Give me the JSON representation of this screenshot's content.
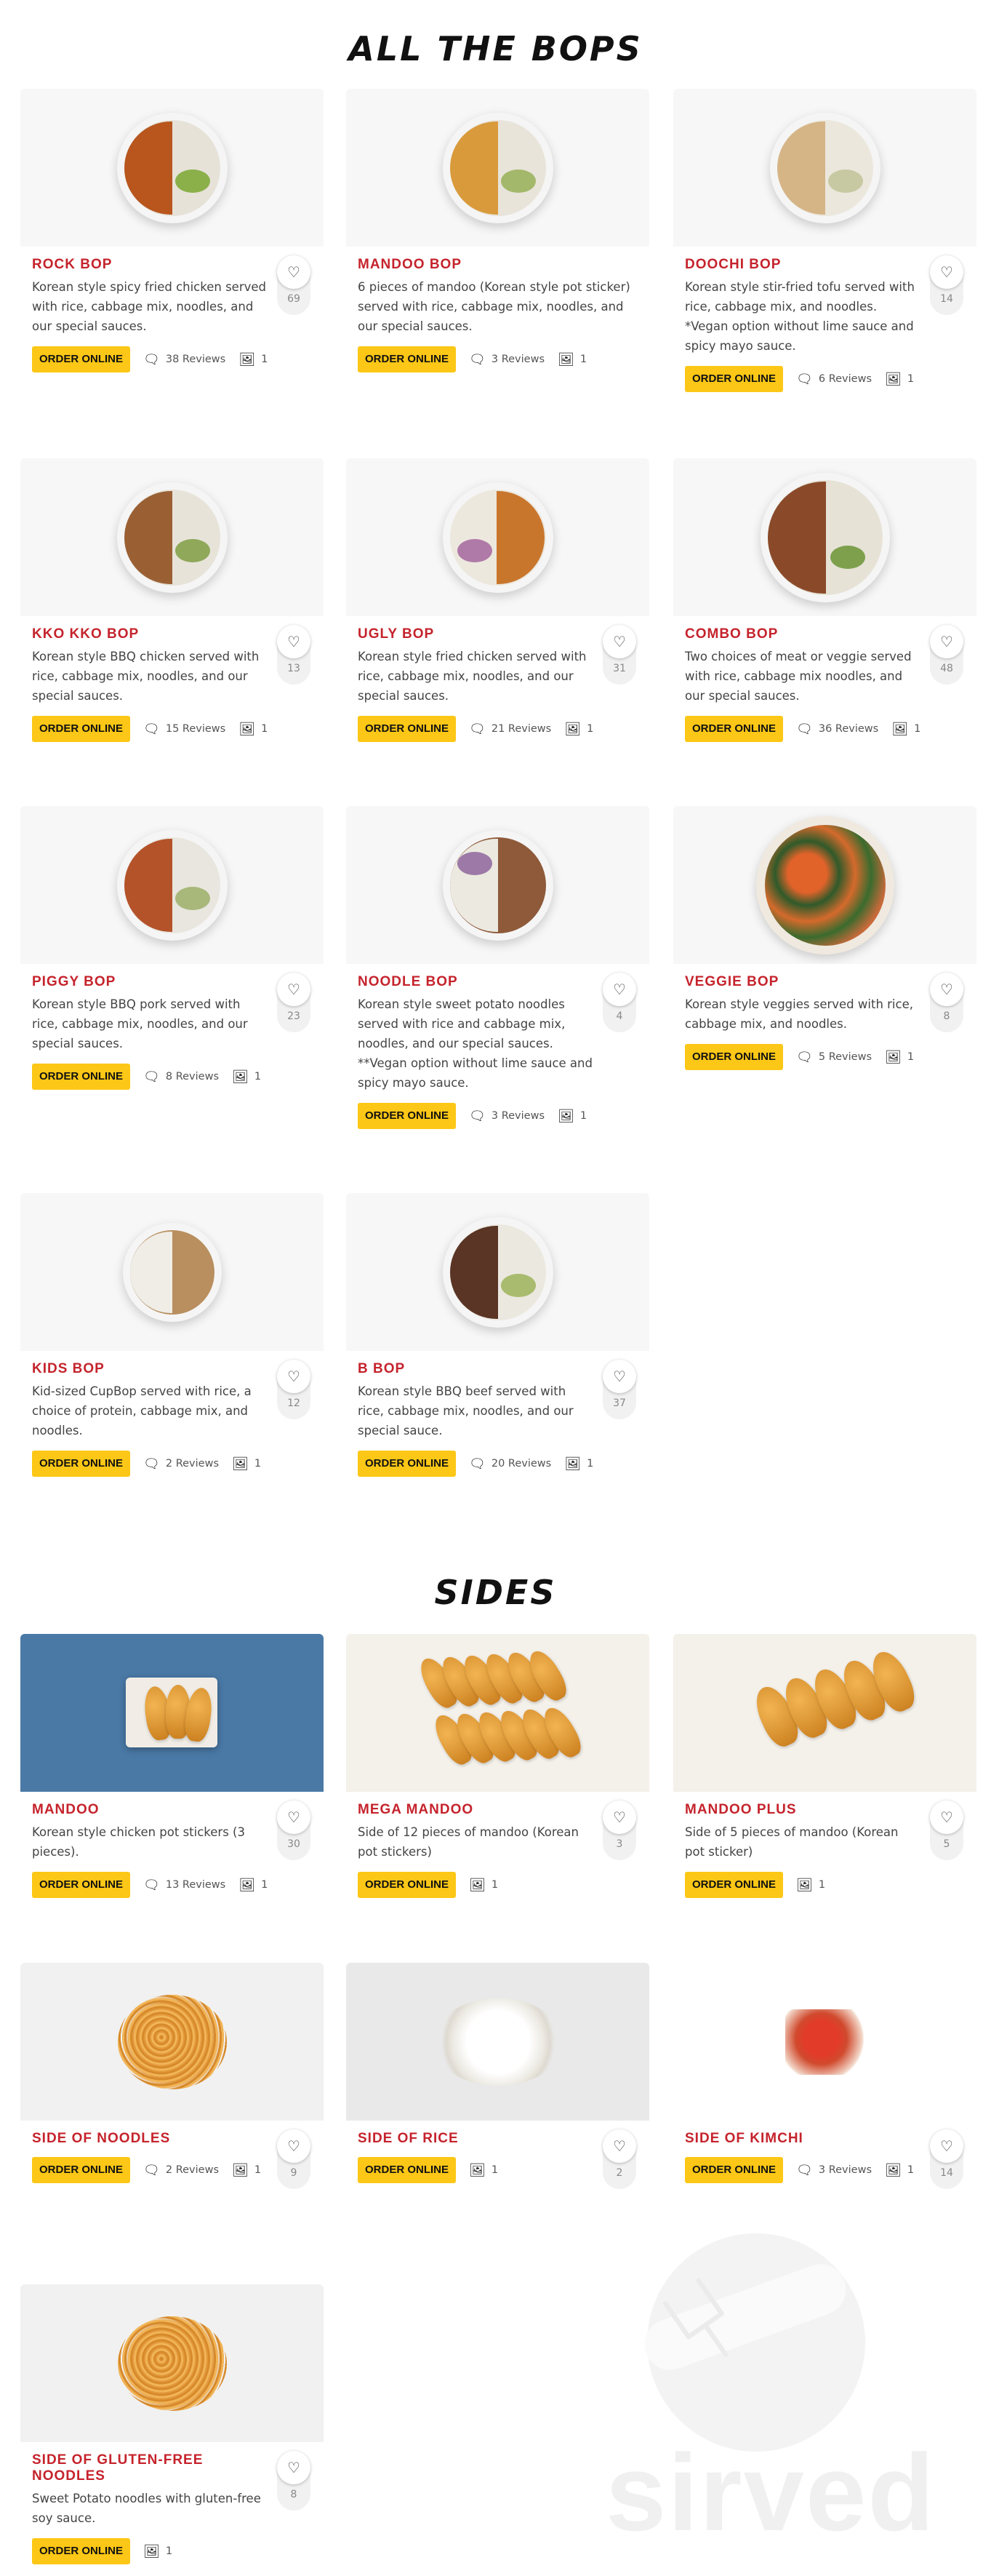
{
  "sections": {
    "bops_title": "ALL THE BOPS",
    "sides_title": "SIDES"
  },
  "labels": {
    "order": "ORDER ONLINE",
    "heart_icon": "heart-icon",
    "review_icon": "comment-icon",
    "photo_icon": "image-icon"
  },
  "colors": {
    "accent_red": "#c5232c",
    "button_yellow": "#fcc716"
  },
  "bops": [
    {
      "name": "ROCK BOP",
      "desc": "Korean style spicy fried chicken served with rice, cabbage mix, noodles, and our special sauces.",
      "likes": "69",
      "reviews": "38 Reviews",
      "photos": "1"
    },
    {
      "name": "MANDOO BOP",
      "desc": "6 pieces of mandoo (Korean style pot sticker) served with rice, cabbage mix, noodles, and our special sauces.",
      "likes": "",
      "reviews": "3 Reviews",
      "photos": "1"
    },
    {
      "name": "DOOCHI BOP",
      "desc": "Korean style stir-fried tofu served with rice, cabbage mix, and noodles. *Vegan option without lime sauce and spicy mayo sauce.",
      "likes": "14",
      "reviews": "6 Reviews",
      "photos": "1"
    },
    {
      "name": "KKO KKO BOP",
      "desc": "Korean style BBQ chicken served with rice, cabbage mix, noodles, and our special sauces.",
      "likes": "13",
      "reviews": "15 Reviews",
      "photos": "1"
    },
    {
      "name": "UGLY BOP",
      "desc": "Korean style fried chicken served with rice, cabbage mix, noodles, and our special sauces.",
      "likes": "31",
      "reviews": "21 Reviews",
      "photos": "1"
    },
    {
      "name": "COMBO BOP",
      "desc": "Two choices of meat or veggie served with rice, cabbage mix noodles, and our special sauces.",
      "likes": "48",
      "reviews": "36 Reviews",
      "photos": "1"
    },
    {
      "name": "PIGGY BOP",
      "desc": "Korean style BBQ pork served with rice, cabbage mix, noodles, and our special sauces.",
      "likes": "23",
      "reviews": "8 Reviews",
      "photos": "1"
    },
    {
      "name": "NOODLE BOP",
      "desc": "Korean style sweet potato noodles served with rice and cabbage mix, noodles, and our special sauces. **Vegan option without lime sauce and spicy mayo sauce.",
      "likes": "4",
      "reviews": "3 Reviews",
      "photos": "1"
    },
    {
      "name": "VEGGIE BOP",
      "desc": "Korean style veggies served with rice, cabbage mix, and noodles.",
      "likes": "8",
      "reviews": "5 Reviews",
      "photos": "1"
    },
    {
      "name": "KIDS BOP",
      "desc": "Kid-sized CupBop served with rice, a choice of protein, cabbage mix, and noodles.",
      "likes": "12",
      "reviews": "2 Reviews",
      "photos": "1"
    },
    {
      "name": "B BOP",
      "desc": "Korean style BBQ beef served with rice, cabbage mix, noodles, and our special sauce.",
      "likes": "37",
      "reviews": "20 Reviews",
      "photos": "1"
    }
  ],
  "sides": [
    {
      "name": "MANDOO",
      "desc": "Korean style chicken pot stickers (3 pieces).",
      "likes": "30",
      "reviews": "13 Reviews",
      "photos": "1"
    },
    {
      "name": "MEGA MANDOO",
      "desc": "Side of 12 pieces of mandoo (Korean pot stickers)",
      "likes": "3",
      "reviews": "",
      "photos": "1"
    },
    {
      "name": "MANDOO PLUS",
      "desc": "Side of 5 pieces of mandoo (Korean pot sticker)",
      "likes": "5",
      "reviews": "",
      "photos": "1"
    },
    {
      "name": "SIDE OF NOODLES",
      "desc": "",
      "likes": "9",
      "reviews": "2 Reviews",
      "photos": "1"
    },
    {
      "name": "SIDE OF RICE",
      "desc": "",
      "likes": "2",
      "reviews": "",
      "photos": "1"
    },
    {
      "name": "SIDE OF KIMCHI",
      "desc": "",
      "likes": "14",
      "reviews": "3 Reviews",
      "photos": "1"
    },
    {
      "name": "SIDE OF GLUTEN-FREE NOODLES",
      "desc": "Sweet Potato noodles with gluten-free soy sauce.",
      "likes": "8",
      "reviews": "",
      "photos": "1"
    }
  ],
  "watermark": {
    "text": "sirved"
  }
}
